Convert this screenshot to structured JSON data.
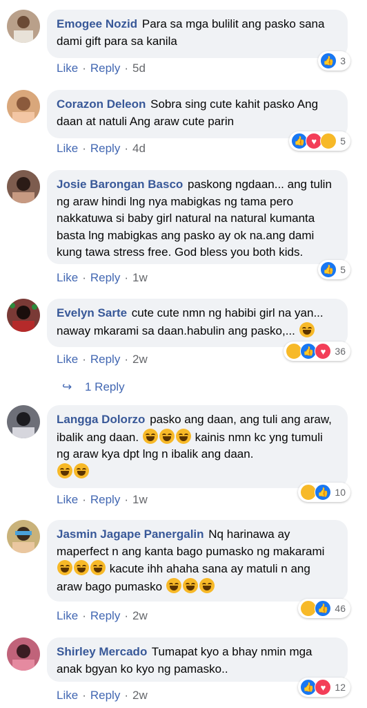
{
  "comments": [
    {
      "name": "Emogee Nozid",
      "text": "Para sa mga bulilit ang pasko sana dami gift para sa kanila",
      "like": "Like",
      "reply": "Reply",
      "time": "5d",
      "count": "3",
      "reactions": [
        "like"
      ],
      "avatar_color": "#b9a08a"
    },
    {
      "name": "Corazon Deleon",
      "text": "Sobra sing cute kahit pasko Ang daan at natuli Ang araw cute parin",
      "like": "Like",
      "reply": "Reply",
      "time": "4d",
      "count": "5",
      "reactions": [
        "like",
        "love",
        "haha"
      ],
      "avatar_color": "#d9a77b"
    },
    {
      "name": "Josie Barongan Basco",
      "text": "paskong ngdaan... ang tulin ng araw hindi lng nya mabigkas ng tama pero nakkatuwa si baby girl natural na natural kumanta basta lng mabigkas ang pasko ay ok na.ang dami kung tawa stress free. God bless you both kids.",
      "like": "Like",
      "reply": "Reply",
      "time": "1w",
      "count": "5",
      "reactions": [
        "like"
      ],
      "avatar_color": "#7d5c4e"
    },
    {
      "name": "Evelyn Sarte",
      "text": "cute cute nmn ng habibi girl na yan... naway mkarami sa daan.habulin ang pasko,...",
      "like": "Like",
      "reply": "Reply",
      "time": "2w",
      "count": "36",
      "reactions": [
        "haha",
        "like",
        "love"
      ],
      "avatar_color": "#7a3a36"
    },
    {
      "name": "Langga Dolorzo",
      "text": "pasko ang daan, ang tuli ang araw, ibalik ang daan.",
      "text2": "kainis nmn kc yng tumuli ng araw kya dpt lng n ibalik ang daan.",
      "like": "Like",
      "reply": "Reply",
      "time": "1w",
      "count": "10",
      "reactions": [
        "haha",
        "like"
      ],
      "avatar_color": "#6d6f78"
    },
    {
      "name": "Jasmin Jagape Panergalin",
      "text": "Nq harinawa ay maperfect n ang kanta bago pumasko ng makarami",
      "text2": "kacute ihh ahaha sana ay matuli n ang araw bago pumasko",
      "like": "Like",
      "reply": "Reply",
      "time": "2w",
      "count": "46",
      "reactions": [
        "haha",
        "like"
      ],
      "avatar_color": "#c9b27a"
    },
    {
      "name": "Shirley Mercado",
      "text": "Tumapat kyo a bhay nmin mga anak bgyan ko kyo ng pamasko..",
      "like": "Like",
      "reply": "Reply",
      "time": "2w",
      "count": "12",
      "reactions": [
        "like",
        "love"
      ],
      "avatar_color": "#c0637a"
    }
  ],
  "replies_link": "1 Reply",
  "colors": {
    "name": "#385898",
    "link": "#4267b2",
    "bubble": "#f0f2f5",
    "meta": "#65676b"
  }
}
